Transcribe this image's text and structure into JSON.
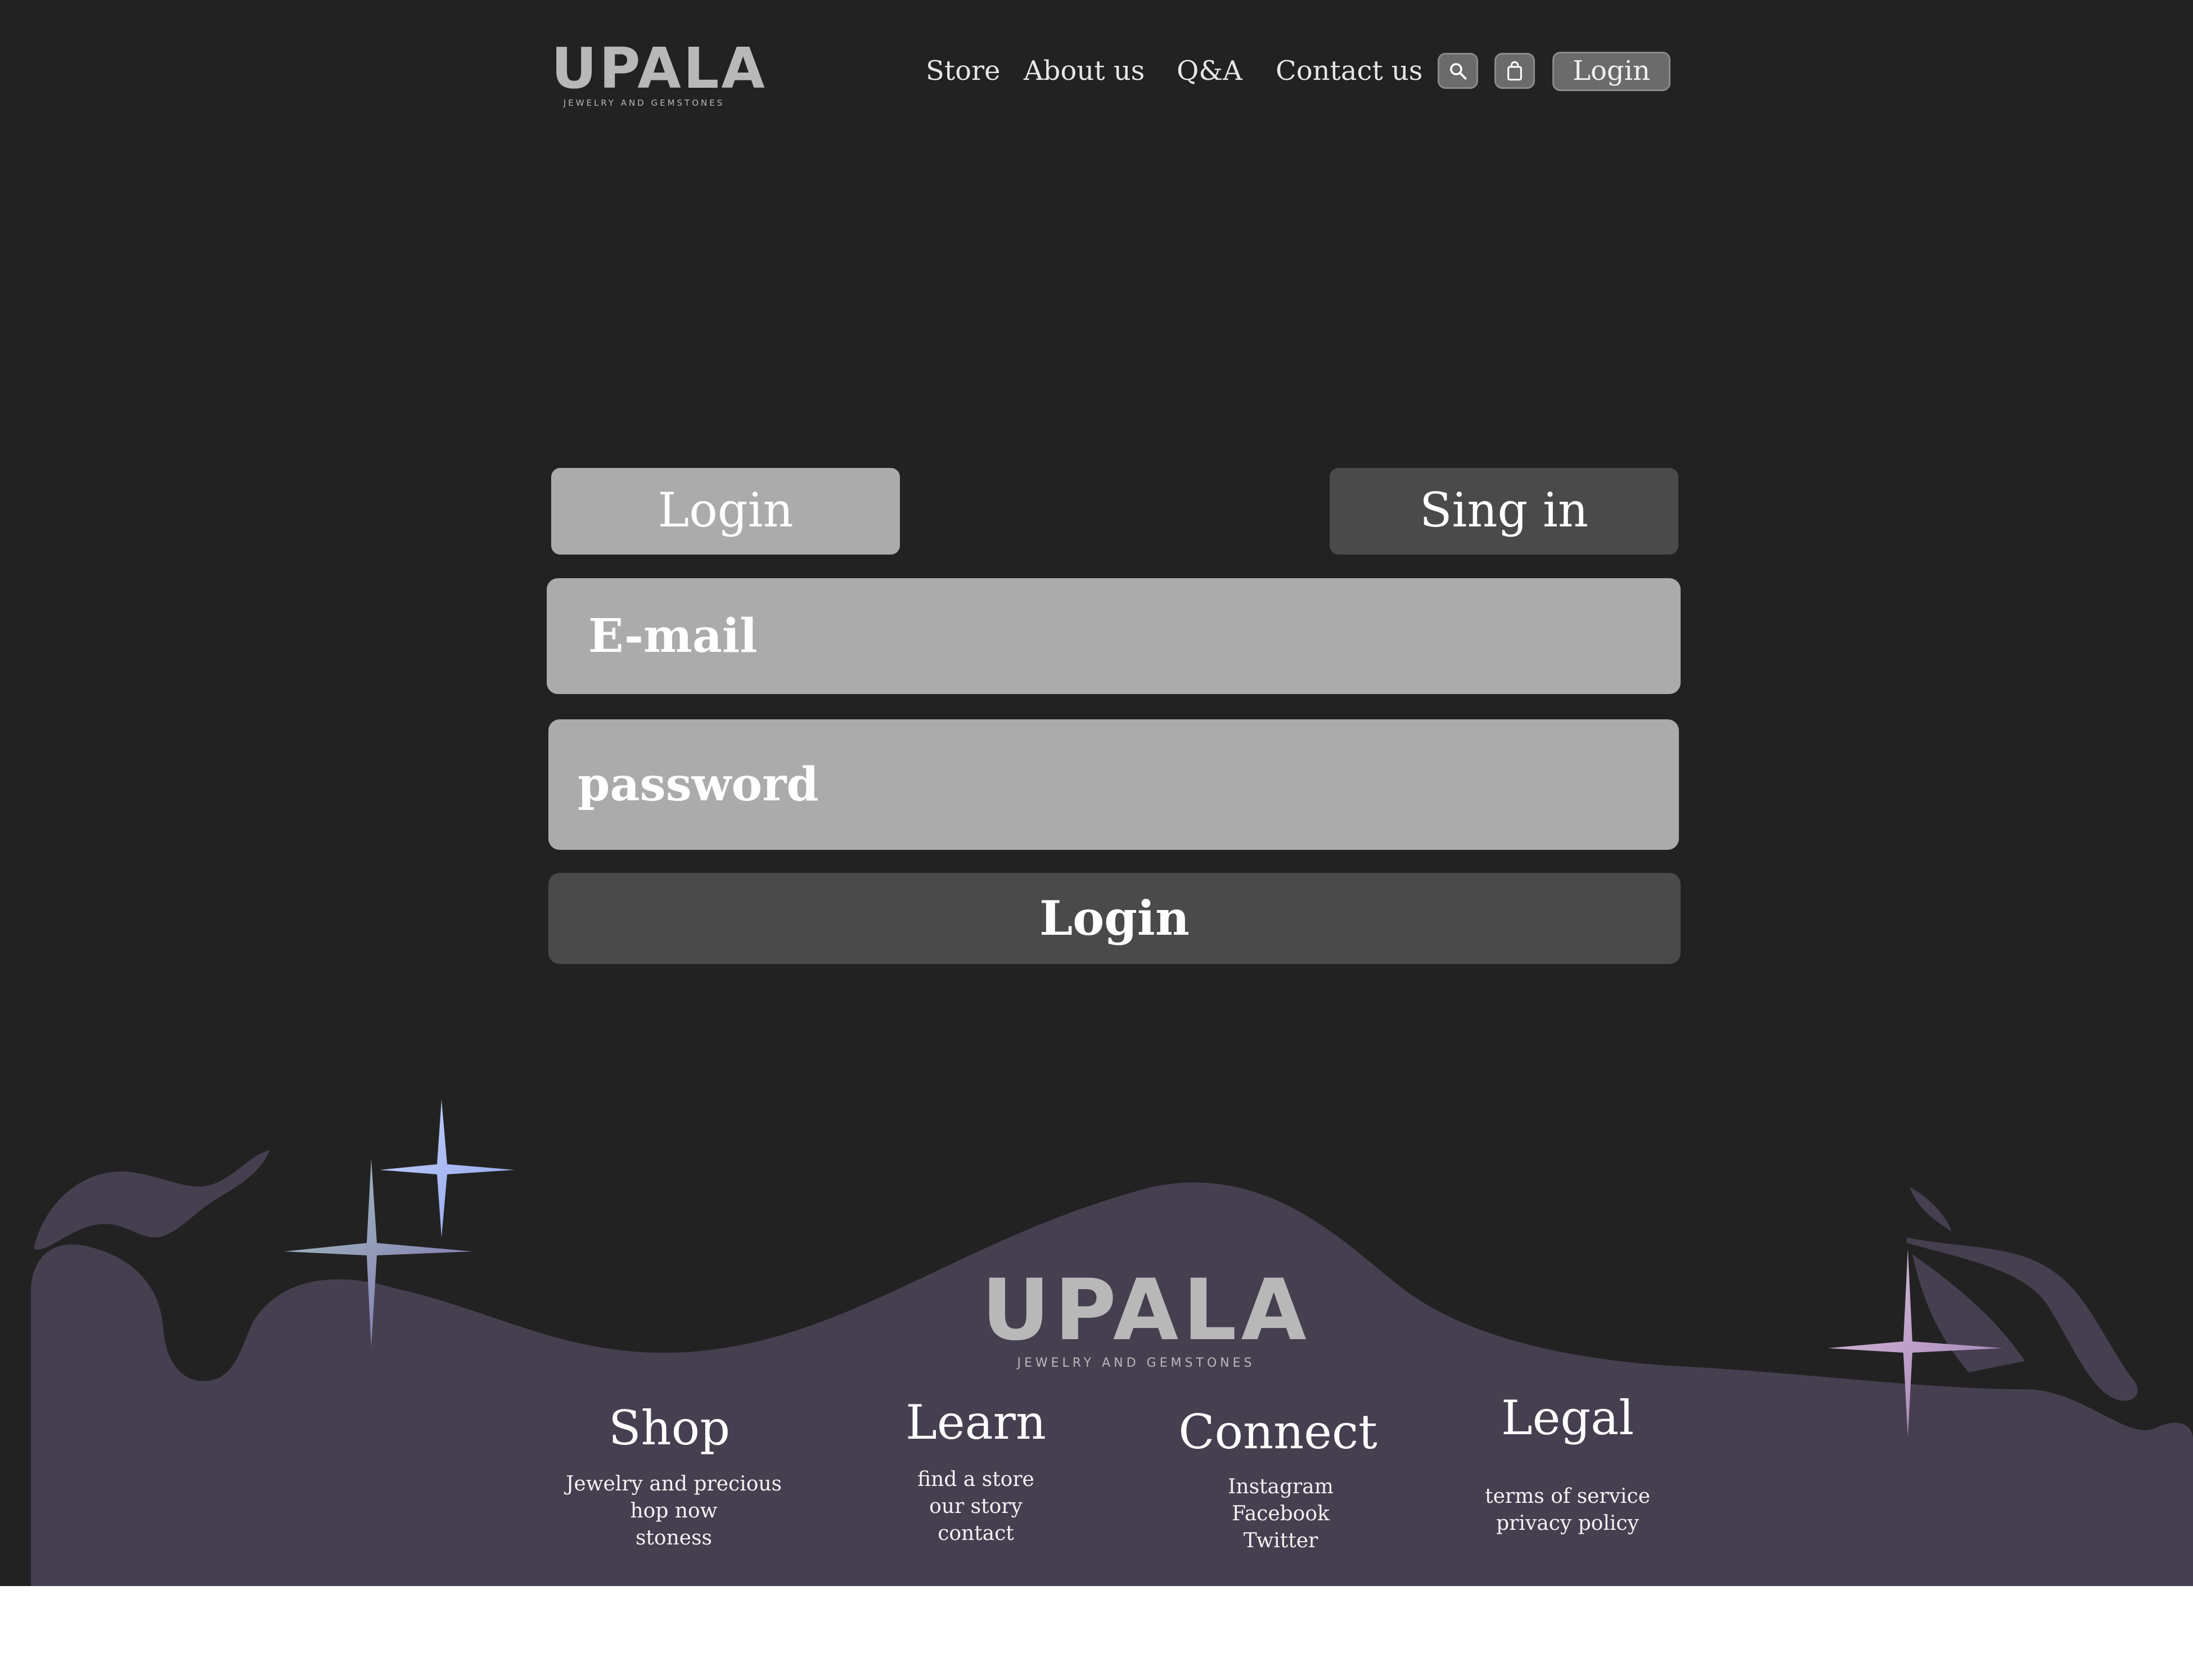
{
  "brand": {
    "name": "UPALA",
    "tagline": "JEWELRY AND GEMSTONES"
  },
  "header": {
    "nav": [
      "Store",
      "About us",
      "Q&A",
      "Contact us"
    ],
    "search_icon": "search-icon",
    "bag_icon": "shopping-bag-icon",
    "login_label": "Login"
  },
  "form": {
    "tab_login": "Login",
    "tab_signin": "Sing in",
    "email_placeholder": "E-mail",
    "password_placeholder": "password",
    "submit_label": "Login"
  },
  "footer": {
    "columns": [
      {
        "title": "Shop",
        "links": [
          "Jewelry and precious",
          "hop now",
          "stoness"
        ]
      },
      {
        "title": "Learn",
        "links": [
          "find a store",
          "our story",
          "contact"
        ]
      },
      {
        "title": "Connect",
        "links": [
          "Instagram",
          "Facebook",
          "Twitter"
        ]
      },
      {
        "title": "Legal",
        "links": [
          "terms of service",
          "privacy policy"
        ]
      }
    ]
  },
  "colors": {
    "background": "#222222",
    "footer_wave": "#463f50",
    "input": "#ababab",
    "dark_button": "#4a4a4a",
    "logo": "#b8b8b8"
  }
}
